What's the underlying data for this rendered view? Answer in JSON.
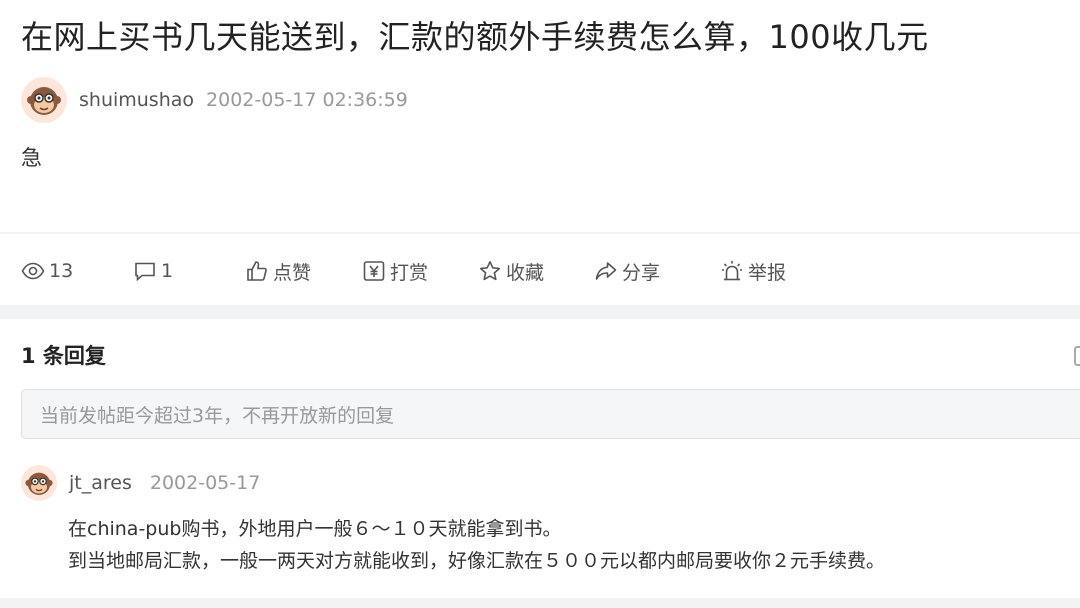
{
  "post": {
    "title": "在网上买书几天能送到，汇款的额外手续费怎么算，100收几元",
    "author": "shuimushao",
    "date": "2002-05-17 02:36:59",
    "body": "急"
  },
  "actions": {
    "views_count": "13",
    "comments_count": "1",
    "like_label": "点赞",
    "reward_label": "打赏",
    "favorite_label": "收藏",
    "share_label": "分享",
    "report_label": "举报"
  },
  "replies": {
    "heading": "1 条回复",
    "input_placeholder": "当前发帖距今超过3年，不再开放新的回复",
    "items": [
      {
        "author": "jt_ares",
        "date": "2002-05-17",
        "lines": [
          "在china-pub购书，外地用户一般６～１０天就能拿到书。",
          "到当地邮局汇款，一般一两天对方就能收到，好像汇款在５００元以都内邮局要收你２元手续费。"
        ]
      }
    ]
  },
  "icons": {
    "avatar": "monkey-avatar-icon",
    "views": "eye-icon",
    "comments": "comment-icon",
    "like": "thumbs-up-icon",
    "reward": "yen-icon",
    "favorite": "star-icon",
    "share": "share-icon",
    "report": "alarm-icon"
  }
}
